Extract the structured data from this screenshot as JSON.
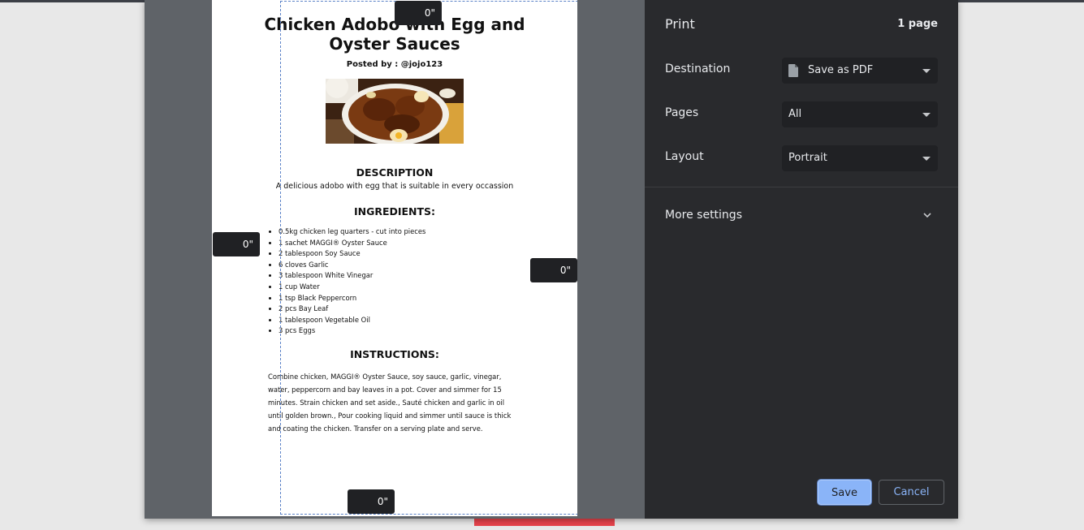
{
  "document": {
    "title": "Chicken Adobo with Egg and Oyster Sauces",
    "posted_by": "Posted by : @jojo123",
    "description_heading": "DESCRIPTION",
    "description_text": "A delicious adobo with egg that is suitable in every occassion",
    "ingredients_heading": "INGREDIENTS:",
    "ingredients": [
      "0.5kg chicken leg quarters - cut into pieces",
      "1 sachet MAGGI® Oyster Sauce",
      "2 tablespoon Soy Sauce",
      "6 cloves Garlic",
      "3 tablespoon White Vinegar",
      "1 cup Water",
      "1 tsp Black Peppercorn",
      "2 pcs Bay Leaf",
      "1 tablespoon Vegetable Oil",
      "3 pcs Eggs"
    ],
    "instructions_heading": "INSTRUCTIONS:",
    "instructions_text": "Combine chicken, MAGGI® Oyster Sauce, soy sauce, garlic, vinegar, water, peppercorn and bay leaves in a pot. Cover and simmer for 15 minutes. Strain chicken and set aside., Sauté chicken and garlic in oil until golden brown., Pour cooking liquid and simmer until sauce is thick and coating the chicken. Transfer on a serving plate and serve."
  },
  "margins": {
    "top": "0\"",
    "left": "0\"",
    "right": "0\"",
    "bottom": "0\""
  },
  "print_settings": {
    "title": "Print",
    "page_count": "1 page",
    "destination_label": "Destination",
    "destination_value": "Save as PDF",
    "pages_label": "Pages",
    "pages_value": "All",
    "layout_label": "Layout",
    "layout_value": "Portrait",
    "more_settings": "More settings",
    "save_label": "Save",
    "cancel_label": "Cancel"
  },
  "icons": {
    "destination": "document-icon",
    "dropdown": "caret-down-icon",
    "more_settings": "chevron-down-icon"
  },
  "colors": {
    "accent": "#8ab4f8",
    "panel_bg": "#292a2d",
    "preview_bg": "#5f6368",
    "margin_box_bg": "#202124"
  }
}
